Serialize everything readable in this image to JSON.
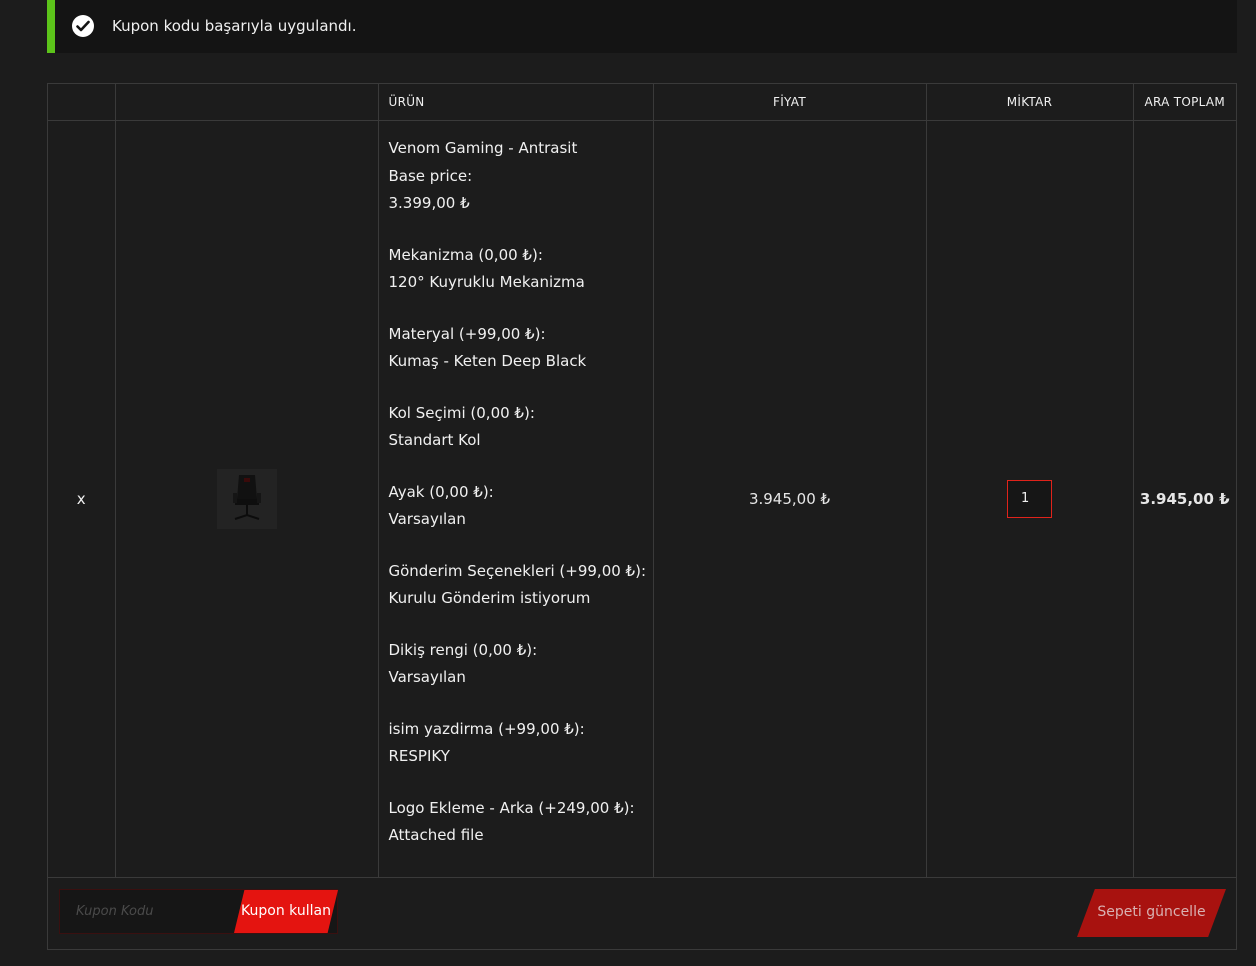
{
  "notice": {
    "message": "Kupon kodu başarıyla uygulandı.",
    "icon": "check-circle-icon",
    "accent_color": "#5cc41a"
  },
  "table": {
    "headers": [
      "",
      "",
      "ÜRÜN",
      "FİYAT",
      "MİKTAR",
      "ARA TOPLAM"
    ]
  },
  "item": {
    "remove_label": "x",
    "name": "Venom Gaming - Antrasit",
    "options": [
      {
        "label": "Base price:",
        "value": "3.399,00 ₺"
      },
      {
        "label": "Mekanizma (0,00 ₺):",
        "value": "120° Kuyruklu Mekanizma"
      },
      {
        "label": "Materyal (+99,00 ₺):",
        "value": "Kumaş - Keten Deep Black"
      },
      {
        "label": "Kol Seçimi (0,00 ₺):",
        "value": "Standart Kol"
      },
      {
        "label": "Ayak (0,00 ₺):",
        "value": "Varsayılan"
      },
      {
        "label": "Gönderim Seçenekleri (+99,00 ₺):",
        "value": "Kurulu Gönderim istiyorum"
      },
      {
        "label": "Dikiş rengi (0,00 ₺):",
        "value": "Varsayılan"
      },
      {
        "label": "isim yazdirma (+99,00 ₺):",
        "value": "RESPIKY"
      },
      {
        "label": "Logo Ekleme - Arka (+249,00 ₺):",
        "value": "Attached file"
      }
    ],
    "price": "3.945,00 ₺",
    "quantity": "1",
    "subtotal": "3.945,00 ₺"
  },
  "actions": {
    "coupon_placeholder": "Kupon Kodu",
    "apply_label": "Kupon kullan",
    "update_label": "Sepeti güncelle",
    "accent_color": "#e41410"
  }
}
